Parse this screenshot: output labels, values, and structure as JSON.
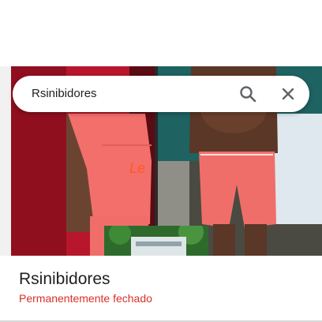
{
  "search": {
    "query": "Rsinibidores"
  },
  "place": {
    "name": "Rsinibidores",
    "status": "Permanentemente fechado"
  },
  "colors": {
    "status_closed": "#d93025",
    "shorts": "#f06e6a"
  },
  "icons": {
    "search": "search-icon",
    "close": "close-icon"
  }
}
